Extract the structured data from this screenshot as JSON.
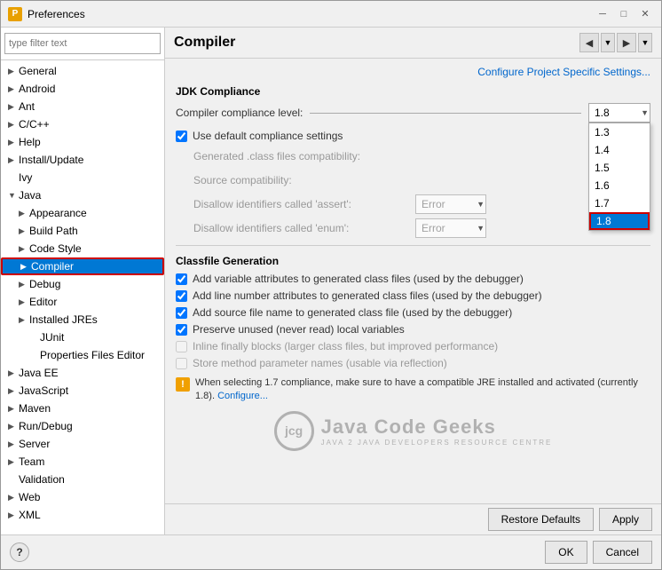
{
  "window": {
    "title": "Preferences",
    "icon": "P"
  },
  "sidebar": {
    "filter_placeholder": "type filter text",
    "items": [
      {
        "id": "general",
        "label": "General",
        "level": 0,
        "arrow": "▶",
        "expanded": false
      },
      {
        "id": "android",
        "label": "Android",
        "level": 0,
        "arrow": "▶",
        "expanded": false
      },
      {
        "id": "ant",
        "label": "Ant",
        "level": 0,
        "arrow": "▶",
        "expanded": false
      },
      {
        "id": "cpp",
        "label": "C/C++",
        "level": 0,
        "arrow": "▶",
        "expanded": false
      },
      {
        "id": "help",
        "label": "Help",
        "level": 0,
        "arrow": "▶",
        "expanded": false
      },
      {
        "id": "install",
        "label": "Install/Update",
        "level": 0,
        "arrow": "▶",
        "expanded": false
      },
      {
        "id": "ivy",
        "label": "Ivy",
        "level": 0,
        "arrow": "",
        "expanded": false
      },
      {
        "id": "java",
        "label": "Java",
        "level": 0,
        "arrow": "▼",
        "expanded": true
      },
      {
        "id": "appearance",
        "label": "Appearance",
        "level": 1,
        "arrow": "▶",
        "expanded": false
      },
      {
        "id": "buildpath",
        "label": "Build Path",
        "level": 1,
        "arrow": "▶",
        "expanded": false
      },
      {
        "id": "codestyle",
        "label": "Code Style",
        "level": 1,
        "arrow": "▶",
        "expanded": false
      },
      {
        "id": "compiler",
        "label": "Compiler",
        "level": 1,
        "arrow": "▶",
        "expanded": false,
        "selected": true
      },
      {
        "id": "debug",
        "label": "Debug",
        "level": 1,
        "arrow": "▶",
        "expanded": false
      },
      {
        "id": "editor",
        "label": "Editor",
        "level": 1,
        "arrow": "▶",
        "expanded": false
      },
      {
        "id": "installed_jres",
        "label": "Installed JREs",
        "level": 1,
        "arrow": "▶",
        "expanded": false
      },
      {
        "id": "junit",
        "label": "JUnit",
        "level": 2,
        "arrow": "",
        "expanded": false
      },
      {
        "id": "propfiles",
        "label": "Properties Files Editor",
        "level": 2,
        "arrow": "",
        "expanded": false
      },
      {
        "id": "java_ee",
        "label": "Java EE",
        "level": 0,
        "arrow": "▶",
        "expanded": false
      },
      {
        "id": "javascript",
        "label": "JavaScript",
        "level": 0,
        "arrow": "▶",
        "expanded": false
      },
      {
        "id": "maven",
        "label": "Maven",
        "level": 0,
        "arrow": "▶",
        "expanded": false
      },
      {
        "id": "rundebug",
        "label": "Run/Debug",
        "level": 0,
        "arrow": "▶",
        "expanded": false
      },
      {
        "id": "server",
        "label": "Server",
        "level": 0,
        "arrow": "▶",
        "expanded": false
      },
      {
        "id": "team",
        "label": "Team",
        "level": 0,
        "arrow": "▶",
        "expanded": false
      },
      {
        "id": "validation",
        "label": "Validation",
        "level": 0,
        "arrow": "",
        "expanded": false
      },
      {
        "id": "web",
        "label": "Web",
        "level": 0,
        "arrow": "▶",
        "expanded": false
      },
      {
        "id": "xml",
        "label": "XML",
        "level": 0,
        "arrow": "▶",
        "expanded": false
      }
    ]
  },
  "panel": {
    "title": "Compiler",
    "config_link": "Configure Project Specific Settings...",
    "jdk_compliance_title": "JDK Compliance",
    "compliance_label": "Compiler compliance level:",
    "compliance_value": "1.8",
    "compliance_options": [
      "1.3",
      "1.4",
      "1.5",
      "1.6",
      "1.7",
      "1.8"
    ],
    "use_default_label": "Use default compliance settings",
    "use_default_checked": true,
    "generated_label": "Generated .class files compatibility:",
    "generated_value": "",
    "source_label": "Source compatibility:",
    "source_value": "",
    "assert_label": "Disallow identifiers called 'assert':",
    "assert_value": "Error",
    "enum_label": "Disallow identifiers called 'enum':",
    "enum_value": "Error",
    "classfile_title": "Classfile Generation",
    "classfile_checks": [
      {
        "label": "Add variable attributes to generated class files (used by the debugger)",
        "checked": true
      },
      {
        "label": "Add line number attributes to generated class files (used by the debugger)",
        "checked": true
      },
      {
        "label": "Add source file name to generated class file (used by the debugger)",
        "checked": true
      },
      {
        "label": "Preserve unused (never read) local variables",
        "checked": true
      },
      {
        "label": "Inline finally blocks (larger class files, but improved performance)",
        "checked": false,
        "disabled": true
      },
      {
        "label": "Store method parameter names (usable via reflection)",
        "checked": false,
        "disabled": true
      }
    ],
    "warning_text": "When selecting 1.7 compliance, make sure to have a compatible JRE installed and activated (currently 1.8).",
    "warning_link": "Configure...",
    "logo_initials": "jcg",
    "logo_brand": "Java Code Geeks",
    "logo_sub": "JAVA 2 JAVA DEVELOPERS RESOURCE CENTRE"
  },
  "footer": {
    "restore_label": "Restore Defaults",
    "apply_label": "Apply",
    "ok_label": "OK",
    "cancel_label": "Cancel"
  }
}
